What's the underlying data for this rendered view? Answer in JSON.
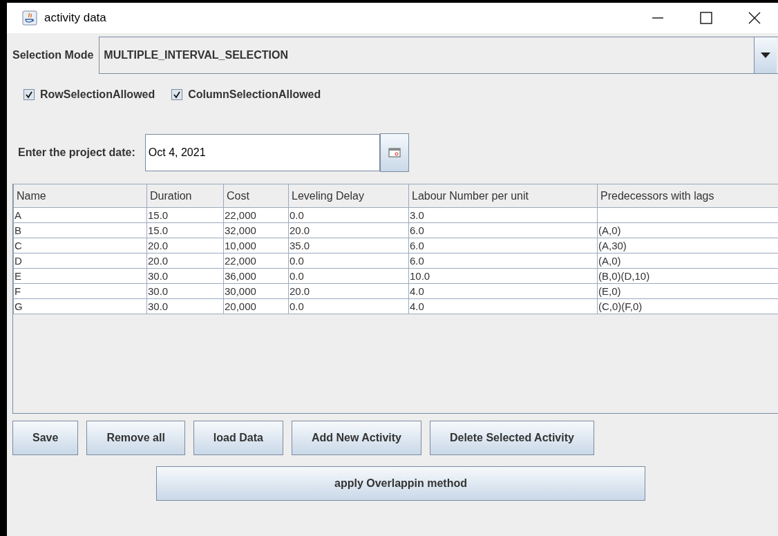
{
  "window": {
    "title": "activity data"
  },
  "selection_mode": {
    "label": "Selection Mode",
    "value": "MULTIPLE_INTERVAL_SELECTION"
  },
  "checkboxes": [
    {
      "label": "RowSelectionAllowed",
      "checked": true
    },
    {
      "label": "ColumnSelectionAllowed",
      "checked": true
    }
  ],
  "project_date": {
    "label": "Enter the project date:",
    "value": "Oct 4, 2021"
  },
  "table": {
    "columns": [
      "Name",
      "Duration",
      "Cost",
      "Leveling Delay",
      "Labour Number per unit",
      "Predecessors with lags"
    ],
    "rows": [
      [
        "A",
        "15.0",
        "22,000",
        "0.0",
        "3.0"
      ],
      [
        "B",
        "15.0",
        "32,000",
        "20.0",
        "6.0",
        "(A,0)"
      ],
      [
        "C",
        "20.0",
        "10,000",
        "35.0",
        "6.0",
        "(A,30)"
      ],
      [
        "D",
        "20.0",
        "22,000",
        "0.0",
        "6.0",
        "(A,0)"
      ],
      [
        "E",
        "30.0",
        "36,000",
        "0.0",
        "10.0",
        "(B,0)(D,10)"
      ],
      [
        "F",
        "30.0",
        "30,000",
        "20.0",
        "4.0",
        "(E,0)"
      ],
      [
        "G",
        "30.0",
        "20,000",
        "0.0",
        "4.0",
        "(C,0)(F,0)"
      ]
    ]
  },
  "buttons": [
    "Save",
    "Remove all",
    "load Data",
    "Add New Activity",
    "Delete Selected Activity"
  ],
  "apply_button": "apply Overlappin method"
}
